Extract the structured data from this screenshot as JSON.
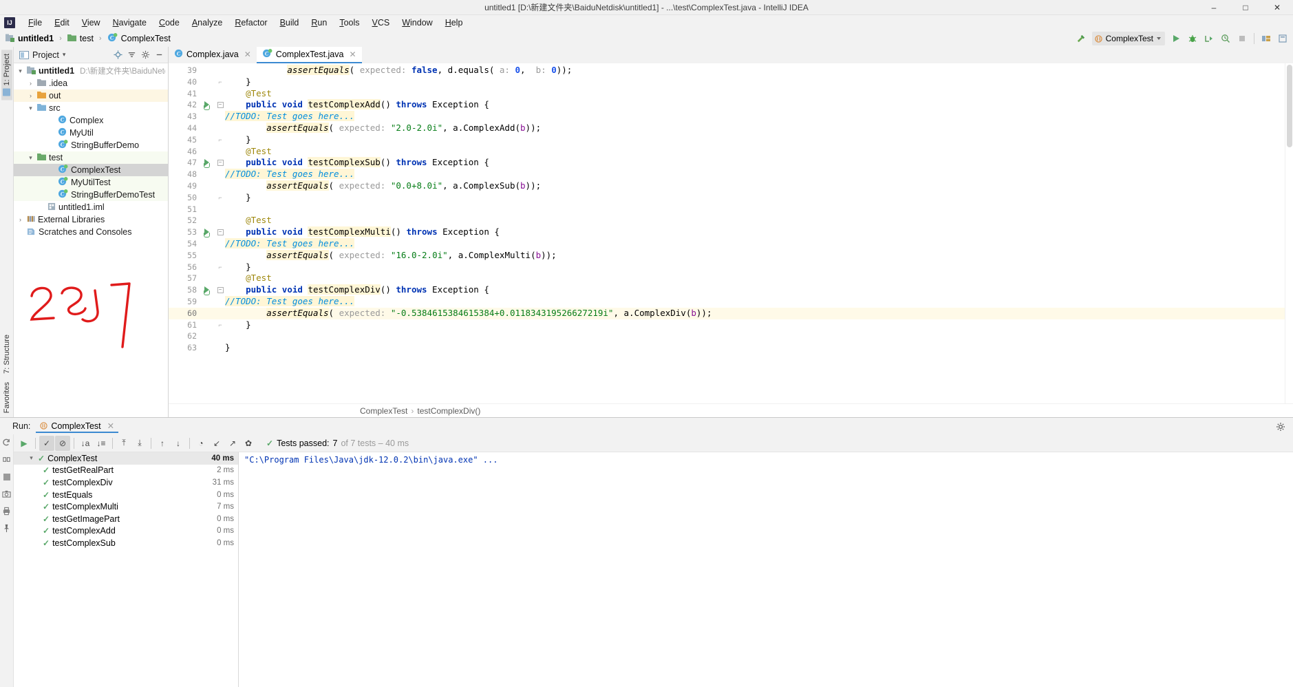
{
  "window": {
    "title": "untitled1 [D:\\新建文件夹\\BaiduNetdisk\\untitled1] - ...\\test\\ComplexTest.java - IntelliJ IDEA",
    "minimize": "–",
    "maximize": "□",
    "close": "✕"
  },
  "menu": {
    "logo": "IJ",
    "items": [
      "File",
      "Edit",
      "View",
      "Navigate",
      "Code",
      "Analyze",
      "Refactor",
      "Build",
      "Run",
      "Tools",
      "VCS",
      "Window",
      "Help"
    ]
  },
  "breadcrumb": {
    "items": [
      {
        "label": "untitled1",
        "icon": "module-icon",
        "bold": true
      },
      {
        "label": "test",
        "icon": "folder-green-icon",
        "bold": false
      },
      {
        "label": "ComplexTest",
        "icon": "class-test-icon",
        "bold": false
      }
    ],
    "separator": "›"
  },
  "toolbar": {
    "build_icon": "hammer-icon",
    "run_config": "ComplexTest",
    "run_icon": "run-icon",
    "debug_icon": "debug-icon",
    "run_coverage_icon": "run-with-coverage-icon",
    "profile_icon": "profiler-icon",
    "stop_icon": "stop-icon",
    "layout_icon": "layout-icon",
    "search_icon": "search-everywhere-icon"
  },
  "project_panel": {
    "title": "Project",
    "caret": "▾",
    "icons": [
      "locate-icon",
      "collapse-all-icon",
      "settings-icon",
      "hide-icon"
    ],
    "tree": [
      {
        "label": "untitled1",
        "path": "D:\\新建文件夹\\BaiduNetd",
        "indent": 0,
        "twisty": "▾",
        "icon": "module-icon",
        "bold": true,
        "state": ""
      },
      {
        "label": ".idea",
        "path": "",
        "indent": 1,
        "twisty": "›",
        "icon": "folder-gray-icon",
        "bold": false,
        "state": ""
      },
      {
        "label": "out",
        "path": "",
        "indent": 1,
        "twisty": "›",
        "icon": "folder-orange-icon",
        "bold": false,
        "state": "out-hl"
      },
      {
        "label": "src",
        "path": "",
        "indent": 1,
        "twisty": "▾",
        "icon": "folder-blue-icon",
        "bold": false,
        "state": ""
      },
      {
        "label": "Complex",
        "path": "",
        "indent": 3,
        "twisty": "",
        "icon": "class-icon",
        "bold": false,
        "state": ""
      },
      {
        "label": "MyUtil",
        "path": "",
        "indent": 3,
        "twisty": "",
        "icon": "class-icon",
        "bold": false,
        "state": ""
      },
      {
        "label": "StringBufferDemo",
        "path": "",
        "indent": 3,
        "twisty": "",
        "icon": "class-test-icon",
        "bold": false,
        "state": ""
      },
      {
        "label": "test",
        "path": "",
        "indent": 1,
        "twisty": "▾",
        "icon": "folder-green-icon",
        "bold": false,
        "state": "src-hl"
      },
      {
        "label": "ComplexTest",
        "path": "",
        "indent": 3,
        "twisty": "",
        "icon": "class-test-icon",
        "bold": false,
        "state": "selected"
      },
      {
        "label": "MyUtilTest",
        "path": "",
        "indent": 3,
        "twisty": "",
        "icon": "class-test-icon",
        "bold": false,
        "state": "src-hl"
      },
      {
        "label": "StringBufferDemoTest",
        "path": "",
        "indent": 3,
        "twisty": "",
        "icon": "class-test-icon",
        "bold": false,
        "state": "src-hl"
      },
      {
        "label": "untitled1.iml",
        "path": "",
        "indent": 2,
        "twisty": "",
        "icon": "iml-icon",
        "bold": false,
        "state": ""
      },
      {
        "label": "External Libraries",
        "path": "",
        "indent": 0,
        "twisty": "›",
        "icon": "library-icon",
        "bold": false,
        "state": ""
      },
      {
        "label": "Scratches and Consoles",
        "path": "",
        "indent": 0,
        "twisty": "",
        "icon": "scratch-icon",
        "bold": false,
        "state": ""
      }
    ]
  },
  "left_stripe": {
    "project_tab": "1: Project",
    "structure_tab": "7: Structure",
    "favorites_tab": "Favorites"
  },
  "editor": {
    "tabs": [
      {
        "label": "Complex.java",
        "icon": "class-icon",
        "active": false
      },
      {
        "label": "ComplexTest.java",
        "icon": "class-test-icon",
        "active": true
      }
    ],
    "close_glyph": "✕",
    "first_line_number": 39,
    "highlight_line": 60,
    "lines": [
      {
        "n": 39,
        "runmark": false,
        "fold": "",
        "tokens": [
          {
            "t": "            ",
            "c": ""
          },
          {
            "t": "assertEquals",
            "c": "mth"
          },
          {
            "t": "( ",
            "c": ""
          },
          {
            "t": "expected:",
            "c": "hint"
          },
          {
            "t": " ",
            "c": ""
          },
          {
            "t": "false",
            "c": "kw"
          },
          {
            "t": ", d.equals( ",
            "c": ""
          },
          {
            "t": "a:",
            "c": "hint"
          },
          {
            "t": " ",
            "c": ""
          },
          {
            "t": "0",
            "c": "num"
          },
          {
            "t": ",  ",
            "c": ""
          },
          {
            "t": "b:",
            "c": "hint"
          },
          {
            "t": " ",
            "c": ""
          },
          {
            "t": "0",
            "c": "num"
          },
          {
            "t": "));",
            "c": ""
          }
        ]
      },
      {
        "n": 40,
        "runmark": false,
        "fold": "end",
        "tokens": [
          {
            "t": "    }",
            "c": ""
          }
        ]
      },
      {
        "n": 41,
        "runmark": false,
        "fold": "",
        "tokens": [
          {
            "t": "    ",
            "c": ""
          },
          {
            "t": "@Test",
            "c": "ann"
          }
        ]
      },
      {
        "n": 42,
        "runmark": true,
        "fold": "start",
        "tokens": [
          {
            "t": "    ",
            "c": ""
          },
          {
            "t": "public",
            "c": "kw"
          },
          {
            "t": " ",
            "c": ""
          },
          {
            "t": "void",
            "c": "kw"
          },
          {
            "t": " ",
            "c": ""
          },
          {
            "t": "testComplexAdd",
            "c": "mthname"
          },
          {
            "t": "() ",
            "c": ""
          },
          {
            "t": "throws",
            "c": "kw"
          },
          {
            "t": " Exception {",
            "c": ""
          }
        ]
      },
      {
        "n": 43,
        "runmark": false,
        "fold": "",
        "tokens": [
          {
            "t": "//TODO: Test goes here...",
            "c": "todo"
          }
        ]
      },
      {
        "n": 44,
        "runmark": false,
        "fold": "",
        "tokens": [
          {
            "t": "        ",
            "c": ""
          },
          {
            "t": "assertEquals",
            "c": "mth"
          },
          {
            "t": "( ",
            "c": ""
          },
          {
            "t": "expected:",
            "c": "hint"
          },
          {
            "t": " ",
            "c": ""
          },
          {
            "t": "\"2.0-2.0i\"",
            "c": "str"
          },
          {
            "t": ", a.ComplexAdd(",
            "c": ""
          },
          {
            "t": "b",
            "c": "fld"
          },
          {
            "t": "));",
            "c": ""
          }
        ]
      },
      {
        "n": 45,
        "runmark": false,
        "fold": "end",
        "tokens": [
          {
            "t": "    }",
            "c": ""
          }
        ]
      },
      {
        "n": 46,
        "runmark": false,
        "fold": "",
        "tokens": [
          {
            "t": "    ",
            "c": ""
          },
          {
            "t": "@Test",
            "c": "ann"
          }
        ]
      },
      {
        "n": 47,
        "runmark": true,
        "fold": "start",
        "tokens": [
          {
            "t": "    ",
            "c": ""
          },
          {
            "t": "public",
            "c": "kw"
          },
          {
            "t": " ",
            "c": ""
          },
          {
            "t": "void",
            "c": "kw"
          },
          {
            "t": " ",
            "c": ""
          },
          {
            "t": "testComplexSub",
            "c": "mthname"
          },
          {
            "t": "() ",
            "c": ""
          },
          {
            "t": "throws",
            "c": "kw"
          },
          {
            "t": " Exception {",
            "c": ""
          }
        ]
      },
      {
        "n": 48,
        "runmark": false,
        "fold": "",
        "tokens": [
          {
            "t": "//TODO: Test goes here...",
            "c": "todo"
          }
        ]
      },
      {
        "n": 49,
        "runmark": false,
        "fold": "",
        "tokens": [
          {
            "t": "        ",
            "c": ""
          },
          {
            "t": "assertEquals",
            "c": "mth"
          },
          {
            "t": "( ",
            "c": ""
          },
          {
            "t": "expected:",
            "c": "hint"
          },
          {
            "t": " ",
            "c": ""
          },
          {
            "t": "\"0.0+8.0i\"",
            "c": "str"
          },
          {
            "t": ", a.ComplexSub(",
            "c": ""
          },
          {
            "t": "b",
            "c": "fld"
          },
          {
            "t": "));",
            "c": ""
          }
        ]
      },
      {
        "n": 50,
        "runmark": false,
        "fold": "end",
        "tokens": [
          {
            "t": "    }",
            "c": ""
          }
        ]
      },
      {
        "n": 51,
        "runmark": false,
        "fold": "",
        "tokens": [
          {
            "t": "",
            "c": ""
          }
        ]
      },
      {
        "n": 52,
        "runmark": false,
        "fold": "",
        "tokens": [
          {
            "t": "    ",
            "c": ""
          },
          {
            "t": "@Test",
            "c": "ann"
          }
        ]
      },
      {
        "n": 53,
        "runmark": true,
        "fold": "start",
        "tokens": [
          {
            "t": "    ",
            "c": ""
          },
          {
            "t": "public",
            "c": "kw"
          },
          {
            "t": " ",
            "c": ""
          },
          {
            "t": "void",
            "c": "kw"
          },
          {
            "t": " ",
            "c": ""
          },
          {
            "t": "testComplexMulti",
            "c": "mthname"
          },
          {
            "t": "() ",
            "c": ""
          },
          {
            "t": "throws",
            "c": "kw"
          },
          {
            "t": " Exception {",
            "c": ""
          }
        ]
      },
      {
        "n": 54,
        "runmark": false,
        "fold": "",
        "tokens": [
          {
            "t": "//TODO: Test goes here...",
            "c": "todo"
          }
        ]
      },
      {
        "n": 55,
        "runmark": false,
        "fold": "",
        "tokens": [
          {
            "t": "        ",
            "c": ""
          },
          {
            "t": "assertEquals",
            "c": "mth"
          },
          {
            "t": "( ",
            "c": ""
          },
          {
            "t": "expected:",
            "c": "hint"
          },
          {
            "t": " ",
            "c": ""
          },
          {
            "t": "\"16.0-2.0i\"",
            "c": "str"
          },
          {
            "t": ", a.ComplexMulti(",
            "c": ""
          },
          {
            "t": "b",
            "c": "fld"
          },
          {
            "t": "));",
            "c": ""
          }
        ]
      },
      {
        "n": 56,
        "runmark": false,
        "fold": "end",
        "tokens": [
          {
            "t": "    }",
            "c": ""
          }
        ]
      },
      {
        "n": 57,
        "runmark": false,
        "fold": "",
        "tokens": [
          {
            "t": "    ",
            "c": ""
          },
          {
            "t": "@Test",
            "c": "ann"
          }
        ]
      },
      {
        "n": 58,
        "runmark": true,
        "fold": "start",
        "tokens": [
          {
            "t": "    ",
            "c": ""
          },
          {
            "t": "public",
            "c": "kw"
          },
          {
            "t": " ",
            "c": ""
          },
          {
            "t": "void",
            "c": "kw"
          },
          {
            "t": " ",
            "c": ""
          },
          {
            "t": "testComplexDiv",
            "c": "mthname"
          },
          {
            "t": "() ",
            "c": ""
          },
          {
            "t": "throws",
            "c": "kw"
          },
          {
            "t": " Exception {",
            "c": ""
          }
        ]
      },
      {
        "n": 59,
        "runmark": false,
        "fold": "",
        "tokens": [
          {
            "t": "//TODO: Test goes here...",
            "c": "todo"
          }
        ]
      },
      {
        "n": 60,
        "runmark": false,
        "fold": "",
        "highlight": true,
        "tokens": [
          {
            "t": "        ",
            "c": ""
          },
          {
            "t": "assertEquals",
            "c": "mth"
          },
          {
            "t": "( ",
            "c": ""
          },
          {
            "t": "expected:",
            "c": "hint"
          },
          {
            "t": " ",
            "c": ""
          },
          {
            "t": "\"-0.5384615384615384+0.011834319526627219i\"",
            "c": "str"
          },
          {
            "t": ", a.ComplexDiv(",
            "c": ""
          },
          {
            "t": "b",
            "c": "fld"
          },
          {
            "t": "));",
            "c": ""
          }
        ]
      },
      {
        "n": 61,
        "runmark": false,
        "fold": "end",
        "tokens": [
          {
            "t": "    }",
            "c": ""
          }
        ]
      },
      {
        "n": 62,
        "runmark": false,
        "fold": "",
        "tokens": [
          {
            "t": "",
            "c": ""
          }
        ]
      },
      {
        "n": 63,
        "runmark": false,
        "fold": "",
        "tokens": [
          {
            "t": "}",
            "c": ""
          }
        ]
      }
    ],
    "breadcrumb": [
      "ComplexTest",
      "testComplexDiv()"
    ],
    "breadcrumb_sep": "›"
  },
  "run_panel": {
    "label": "Run:",
    "tab": "ComplexTest",
    "tab_close": "✕",
    "settings_icon": "gear-icon",
    "toolbar_buttons": [
      {
        "name": "rerun-button",
        "glyph": "▶",
        "pressed": false
      },
      {
        "name": "show-passed-toggle",
        "glyph": "✓",
        "pressed": true
      },
      {
        "name": "show-ignored-toggle",
        "glyph": "⊘",
        "pressed": true
      },
      {
        "name": "sort-alphabetically-button",
        "glyph": "↓a",
        "pressed": false
      },
      {
        "name": "sort-by-duration-button",
        "glyph": "↓≡",
        "pressed": false
      },
      {
        "name": "expand-all-button",
        "glyph": "⤒",
        "pressed": false
      },
      {
        "name": "collapse-all-button",
        "glyph": "⤓",
        "pressed": false
      },
      {
        "name": "prev-failed-button",
        "glyph": "↑",
        "pressed": false
      },
      {
        "name": "next-failed-button",
        "glyph": "↓",
        "pressed": false
      },
      {
        "name": "history-button",
        "glyph": "◔",
        "pressed": false
      },
      {
        "name": "import-tests-button",
        "glyph": "↙",
        "pressed": false
      },
      {
        "name": "export-tests-button",
        "glyph": "↗",
        "pressed": false
      },
      {
        "name": "test-settings-button",
        "glyph": "✿",
        "pressed": false
      }
    ],
    "status": {
      "check": "✓",
      "passed_label": "Tests passed:",
      "passed_count": "7",
      "of_label": "of 7 tests – 40 ms"
    },
    "tests": [
      {
        "name": "ComplexTest",
        "time": "40 ms",
        "indent": 0,
        "root": true,
        "twisty": "▾"
      },
      {
        "name": "testGetRealPart",
        "time": "2 ms",
        "indent": 1,
        "root": false,
        "twisty": ""
      },
      {
        "name": "testComplexDiv",
        "time": "31 ms",
        "indent": 1,
        "root": false,
        "twisty": ""
      },
      {
        "name": "testEquals",
        "time": "0 ms",
        "indent": 1,
        "root": false,
        "twisty": ""
      },
      {
        "name": "testComplexMulti",
        "time": "7 ms",
        "indent": 1,
        "root": false,
        "twisty": ""
      },
      {
        "name": "testGetImagePart",
        "time": "0 ms",
        "indent": 1,
        "root": false,
        "twisty": ""
      },
      {
        "name": "testComplexAdd",
        "time": "0 ms",
        "indent": 1,
        "root": false,
        "twisty": ""
      },
      {
        "name": "testComplexSub",
        "time": "0 ms",
        "indent": 1,
        "root": false,
        "twisty": ""
      }
    ],
    "console": "\"C:\\Program Files\\Java\\jdk-12.0.2\\bin\\java.exe\" ...",
    "side_icons": [
      "rerun-icon",
      "rerun-failed-icon",
      "stop-icon",
      "screenshot-icon",
      "print-icon",
      "pin-icon"
    ]
  }
}
